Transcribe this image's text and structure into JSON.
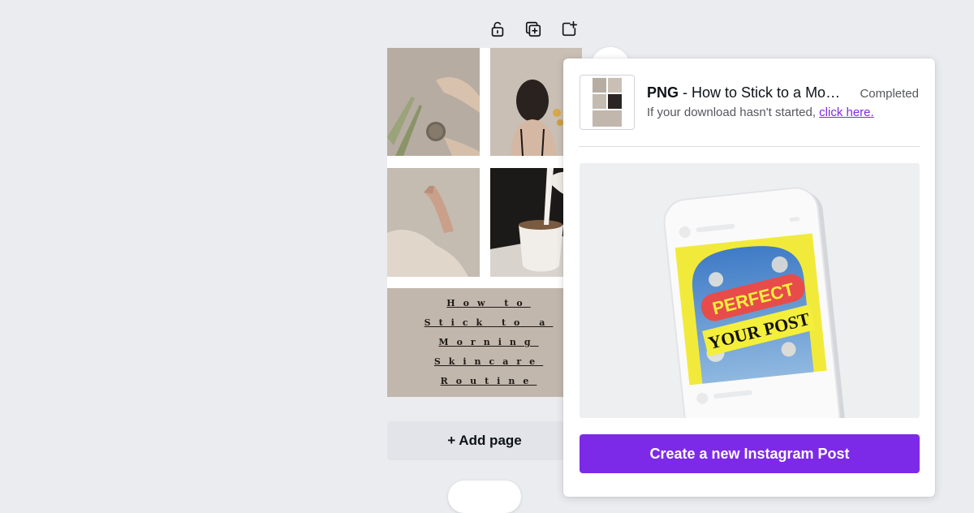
{
  "toolbar": {
    "icons": [
      "unlock-icon",
      "duplicate-page-icon",
      "add-page-icon"
    ]
  },
  "design": {
    "caption_lines": [
      "How to",
      "Stick to a",
      "Morning",
      "Skincare",
      "Routine"
    ]
  },
  "add_page_label": "+ Add page",
  "download_panel": {
    "format": "PNG",
    "title_rest": " - How to Stick to a Mor...",
    "status": "Completed",
    "hint": "If your download hasn't started, ",
    "link": "click here.",
    "promo": {
      "sticker_line1": "PERFECT",
      "sticker_line2": "YOUR POST"
    },
    "cta_label": "Create a new Instagram Post"
  },
  "colors": {
    "accent": "#7d2ae8",
    "caption_bg": "#c2b7ad",
    "canvas_bg": "#ebecf0"
  }
}
